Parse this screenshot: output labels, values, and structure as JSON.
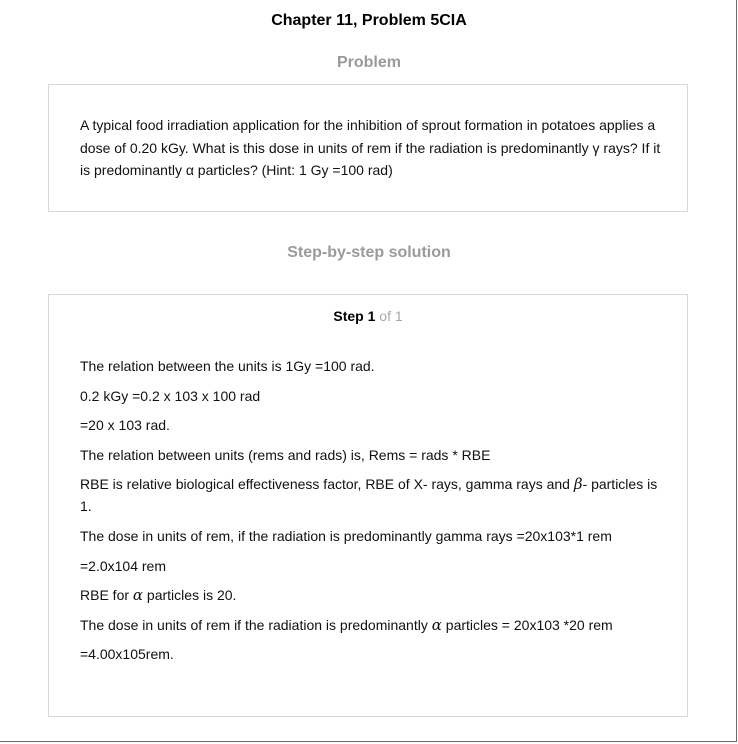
{
  "page": {
    "title": "Chapter 11, Problem 5CIA"
  },
  "problem": {
    "heading": "Problem",
    "text": "A typical food irradiation application for the inhibition of sprout formation in potatoes applies a dose of 0.20 kGy. What is this dose in units of rem if the radiation is predominantly γ rays? If it is predominantly α particles? (Hint: 1 Gy =100 rad)"
  },
  "solution": {
    "heading": "Step-by-step solution",
    "step": {
      "word": "Step",
      "number": "1",
      "of_text": "of 1"
    },
    "lines": {
      "l1": "The relation between the units is 1Gy =100 rad.",
      "l2": "0.2 kGy =0.2 x 103 x 100 rad",
      "l3": "=20 x 103 rad.",
      "l4": "The relation between units (rems and rads) is, Rems = rads * RBE",
      "l5_before": "RBE is relative biological effectiveness factor, RBE of X- rays, gamma rays and ",
      "l5_symbol": "β",
      "l5_after": "- particles is 1.",
      "l6": "The dose in units of rem, if the radiation is predominantly gamma rays =20x103*1 rem",
      "l7": "=2.0x104 rem",
      "l8_before": "RBE for ",
      "l8_symbol": "α",
      "l8_after": " particles is 20.",
      "l9_before": "The dose in units of rem if the radiation is predominantly ",
      "l9_symbol": "α",
      "l9_after": " particles = 20x103 *20 rem",
      "l10": "=4.00x105rem."
    }
  }
}
